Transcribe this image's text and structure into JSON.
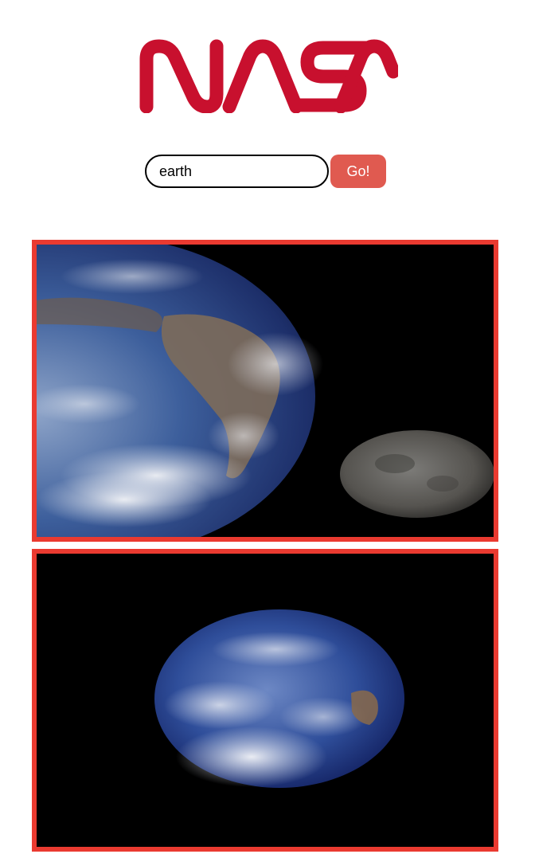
{
  "header": {
    "logo_text": "NASA",
    "logo_color": "#c8102e"
  },
  "search": {
    "value": "earth",
    "button_label": "Go!",
    "button_color": "#e05a50"
  },
  "results": {
    "border_color": "#ea3a30",
    "items": [
      {
        "image": "earth-and-moon-photo"
      },
      {
        "image": "full-earth-photo"
      }
    ]
  }
}
